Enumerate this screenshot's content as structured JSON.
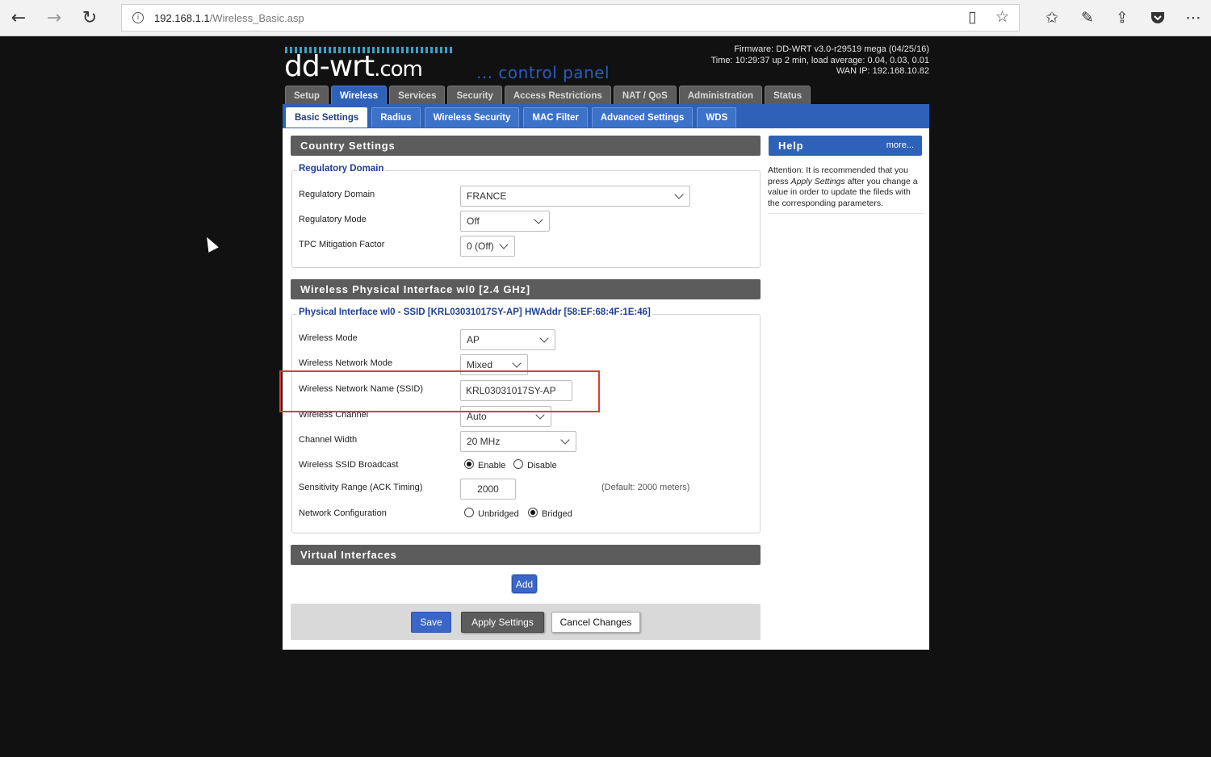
{
  "browser": {
    "url_host": "192.168.1.1",
    "url_path": "/Wireless_Basic.asp",
    "icons": [
      "back-arrow-icon",
      "forward-arrow-icon",
      "refresh-icon",
      "info-icon",
      "reading-view-icon",
      "favorite-star-icon",
      "favorites-list-icon",
      "pen-icon",
      "share-icon",
      "pocket-icon",
      "more-icon"
    ]
  },
  "header": {
    "logo_main": "dd-wrt",
    "logo_suffix": ".com",
    "tagline": "... control panel",
    "firmware": "Firmware: DD-WRT v3.0-r29519 mega (04/25/16)",
    "time": "Time: 10:29:37 up 2 min, load average: 0.04, 0.03, 0.01",
    "wan_ip": "WAN IP: 192.168.10.82"
  },
  "main_tabs": [
    "Setup",
    "Wireless",
    "Services",
    "Security",
    "Access Restrictions",
    "NAT / QoS",
    "Administration",
    "Status"
  ],
  "main_tab_active": "Wireless",
  "sub_tabs": [
    "Basic Settings",
    "Radius",
    "Wireless Security",
    "MAC Filter",
    "Advanced Settings",
    "WDS"
  ],
  "sub_tab_active": "Basic Settings",
  "country": {
    "title": "Country Settings",
    "legend": "Regulatory Domain",
    "rows": [
      {
        "label": "Regulatory Domain",
        "value": "FRANCE"
      },
      {
        "label": "Regulatory Mode",
        "value": "Off"
      },
      {
        "label": "TPC Mitigation Factor",
        "value": "0 (Off)"
      }
    ]
  },
  "physical": {
    "title": "Wireless Physical Interface wl0 [2.4 GHz]",
    "legend": "Physical Interface wl0 - SSID [KRL03031017SY-AP] HWAddr [58:EF:68:4F:1E:46]",
    "wireless_mode": {
      "label": "Wireless Mode",
      "value": "AP"
    },
    "network_mode": {
      "label": "Wireless Network Mode",
      "value": "Mixed"
    },
    "ssid": {
      "label": "Wireless Network Name (SSID)",
      "value": "KRL03031017SY-AP"
    },
    "channel": {
      "label": "Wireless Channel",
      "value": "Auto"
    },
    "channel_width": {
      "label": "Channel Width",
      "value": "20 MHz"
    },
    "ssid_broadcast": {
      "label": "Wireless SSID Broadcast",
      "enable": "Enable",
      "disable": "Disable",
      "selected": "Enable"
    },
    "sensitivity": {
      "label": "Sensitivity Range (ACK Timing)",
      "value": "2000",
      "hint": "(Default: 2000 meters)"
    },
    "network_config": {
      "label": "Network Configuration",
      "unbridged": "Unbridged",
      "bridged": "Bridged",
      "selected": "Bridged"
    }
  },
  "virtual": {
    "title": "Virtual Interfaces",
    "add_label": "Add"
  },
  "actions": {
    "save": "Save",
    "apply": "Apply Settings",
    "cancel": "Cancel Changes"
  },
  "help": {
    "title": "Help",
    "more": "more...",
    "text_before": "Attention: It is recommended that you press ",
    "text_em": "Apply Settings",
    "text_after": " after you change a value in order to update the fileds with the corresponding parameters."
  },
  "colors": {
    "accent_blue": "#2e61b8",
    "section_gray": "#5c5c5c",
    "highlight_red": "#e53935"
  }
}
